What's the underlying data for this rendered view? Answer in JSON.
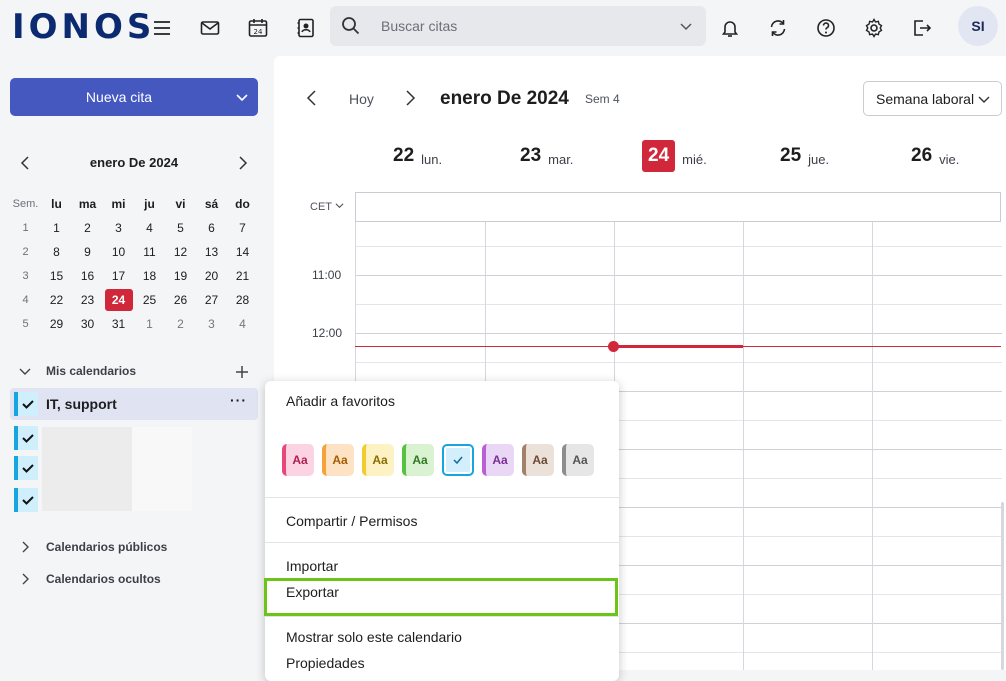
{
  "app": {
    "logo": "IONOS"
  },
  "topbar": {
    "search_placeholder": "Buscar citas",
    "calendar_icon_day": "24",
    "avatar_initials": "SI"
  },
  "sidebar": {
    "new_button": "Nueva cita",
    "mini_calendar": {
      "title": "enero De 2024",
      "week_label": "Sem.",
      "weekdays": [
        "lu",
        "ma",
        "mi",
        "ju",
        "vi",
        "sá",
        "do"
      ],
      "weeks": [
        {
          "wk": "1",
          "days": [
            "1",
            "2",
            "3",
            "4",
            "5",
            "6",
            "7"
          ]
        },
        {
          "wk": "2",
          "days": [
            "8",
            "9",
            "10",
            "11",
            "12",
            "13",
            "14"
          ]
        },
        {
          "wk": "3",
          "days": [
            "15",
            "16",
            "17",
            "18",
            "19",
            "20",
            "21"
          ]
        },
        {
          "wk": "4",
          "days": [
            "22",
            "23",
            "24",
            "25",
            "26",
            "27",
            "28"
          ]
        },
        {
          "wk": "5",
          "days": [
            "29",
            "30",
            "31",
            "1",
            "2",
            "3",
            "4"
          ]
        }
      ]
    },
    "my_calendars_label": "Mis calendarios",
    "calendar_name": "IT, support",
    "more_label": "···",
    "public_calendars_label": "Calendarios públicos",
    "hidden_calendars_label": "Calendarios ocultos"
  },
  "main": {
    "today_label": "Hoy",
    "month_title": "enero De 2024",
    "week_label": "Sem 4",
    "view_selector": "Semana laboral",
    "days": [
      {
        "num": "22",
        "name": "lun."
      },
      {
        "num": "23",
        "name": "mar."
      },
      {
        "num": "24",
        "name": "mié."
      },
      {
        "num": "25",
        "name": "jue."
      },
      {
        "num": "26",
        "name": "vie."
      }
    ],
    "timezone": "CET",
    "times": [
      "11:00",
      "12:00"
    ]
  },
  "context_menu": {
    "items": {
      "favorites": "Añadir a favoritos",
      "share": "Compartir / Permisos",
      "import": "Importar",
      "export": "Exportar",
      "show_only": "Mostrar solo este calendario",
      "properties": "Propiedades"
    },
    "swatch_label": "Aa",
    "swatches": [
      {
        "bg": "#fbd3e3",
        "bar": "#e8477a",
        "fg": "#b0204f"
      },
      {
        "bg": "#fde3c3",
        "bar": "#f5a23a",
        "fg": "#a75b00"
      },
      {
        "bg": "#fdf2c4",
        "bar": "#f2cc2e",
        "fg": "#8c6d00"
      },
      {
        "bg": "#d9f3d2",
        "bar": "#56c23e",
        "fg": "#2f7a20"
      },
      {
        "bg": "#d3effc",
        "bar": "#16a5e0",
        "fg": "#0f6d96"
      },
      {
        "bg": "#ead6f5",
        "bar": "#b95fd6",
        "fg": "#7a2f94"
      },
      {
        "bg": "#ece1d8",
        "bar": "#a3806a",
        "fg": "#6b4a36"
      },
      {
        "bg": "#e6e6e6",
        "bar": "#8d8d8d",
        "fg": "#555555"
      }
    ]
  },
  "colors": {
    "accent": "#4458c0",
    "today": "#d1273b",
    "calendar": "#16a5e0",
    "highlight": "#6cc417"
  }
}
